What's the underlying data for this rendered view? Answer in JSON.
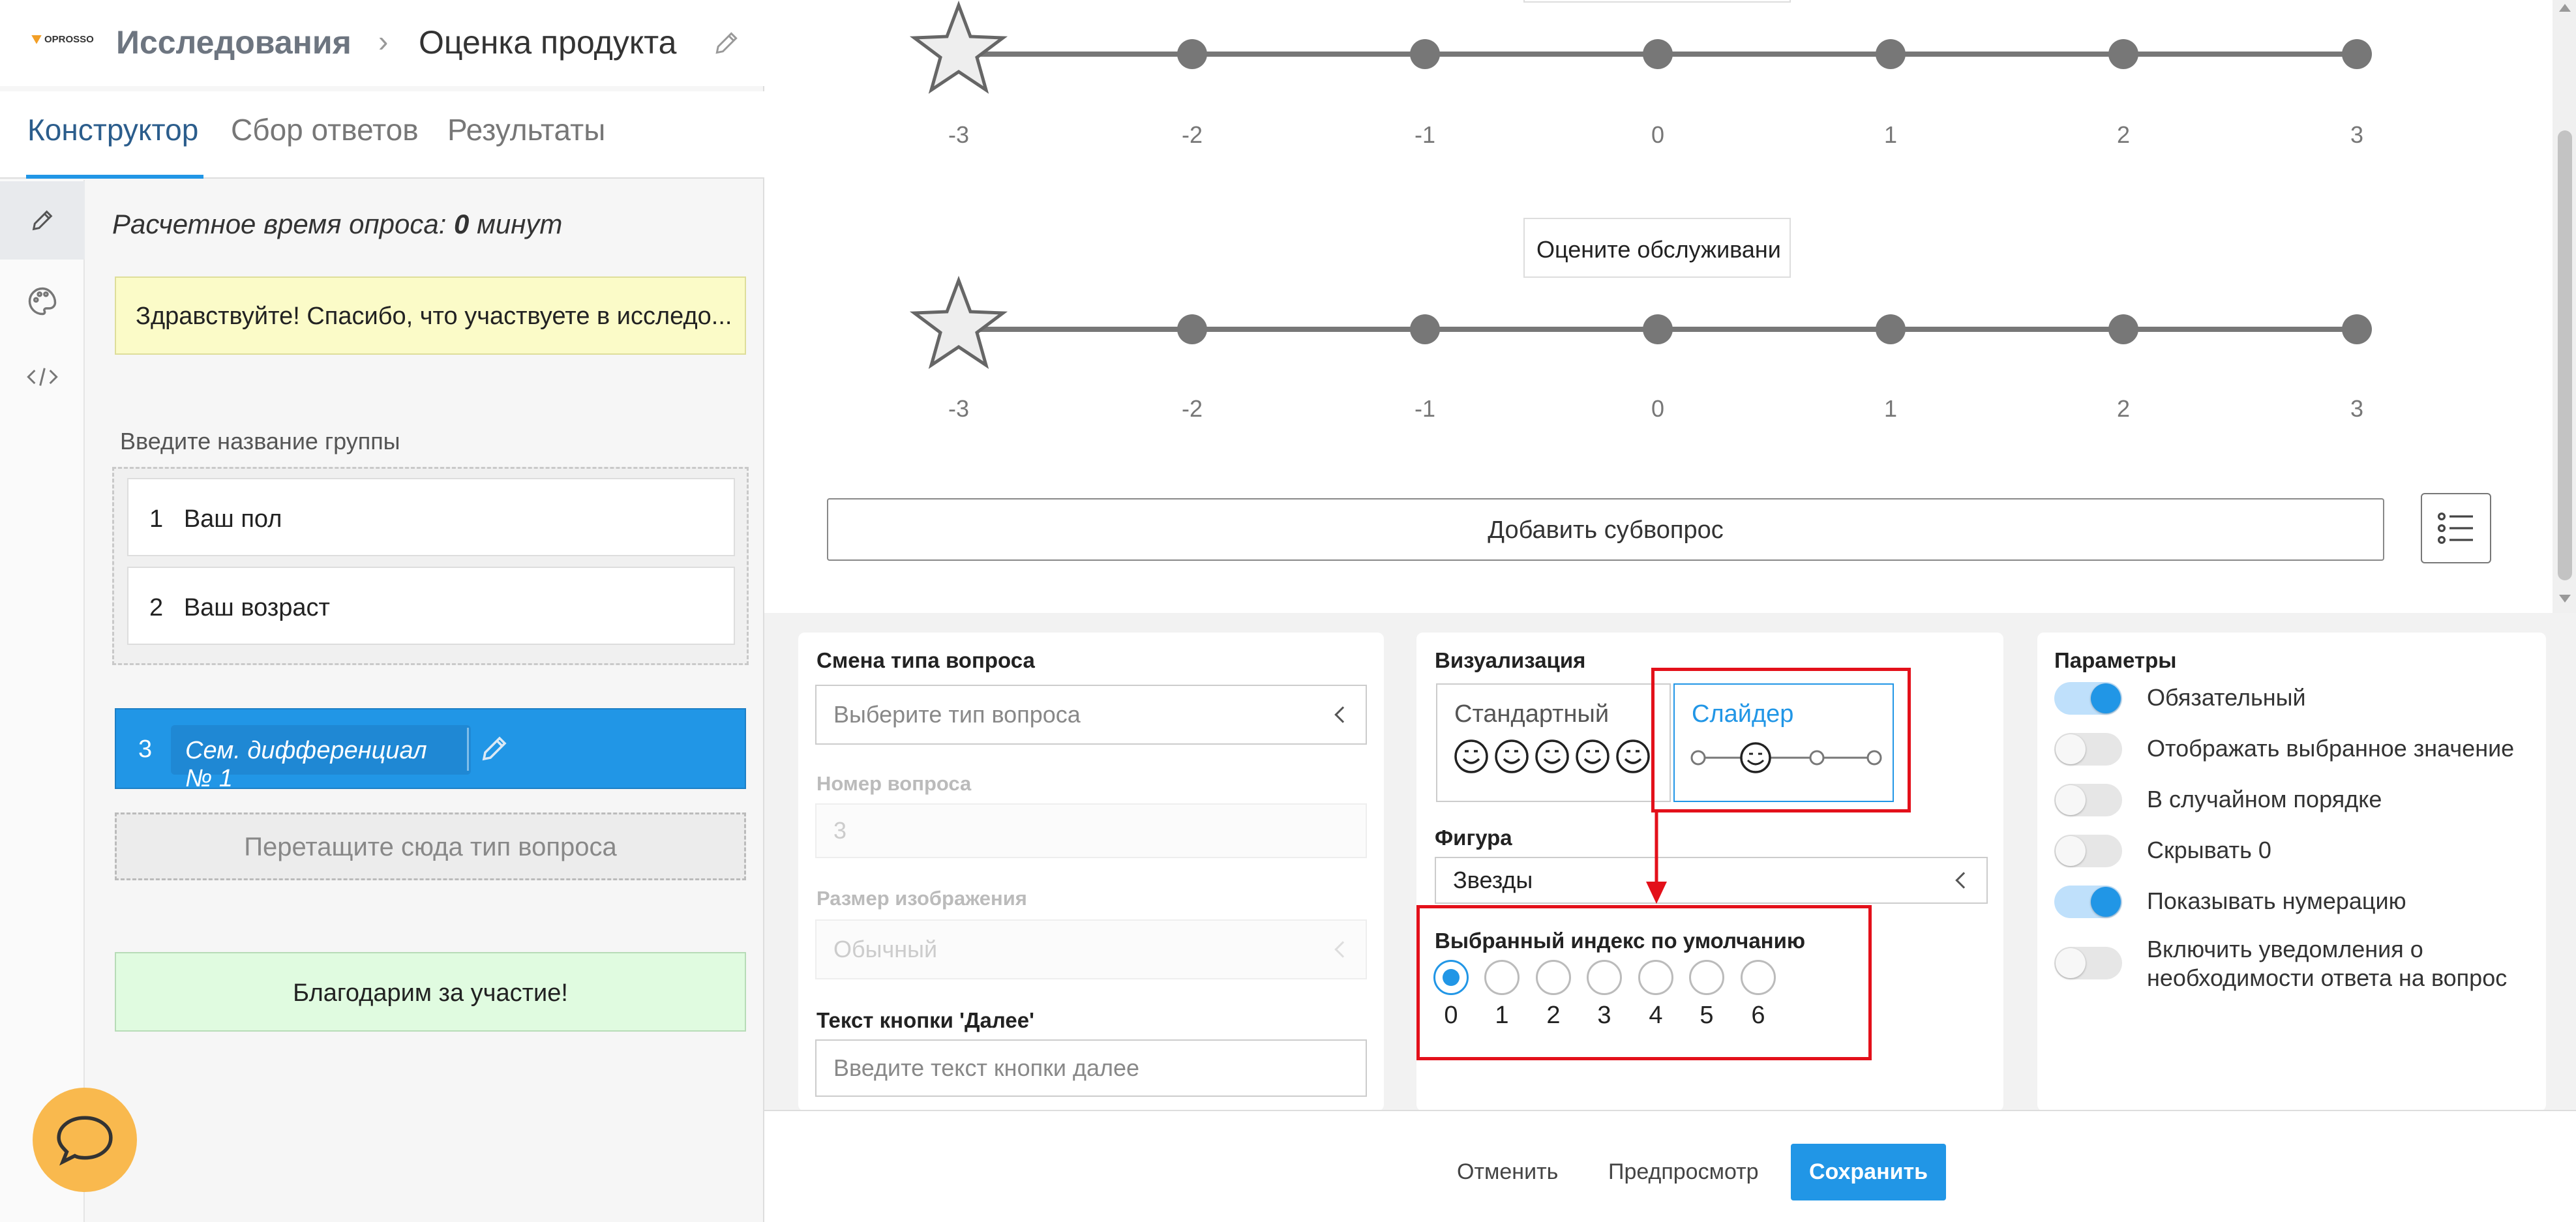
{
  "header": {
    "logo": "OPROSSO",
    "breadcrumb_root": "Исследования",
    "breadcrumb_sep": "›",
    "breadcrumb_current": "Оценка продукта"
  },
  "tabs": [
    {
      "label": "Конструктор",
      "active": true
    },
    {
      "label": "Сбор ответов",
      "active": false
    },
    {
      "label": "Результаты",
      "active": false
    }
  ],
  "rail": [
    "pencil-icon",
    "palette-icon",
    "code-icon"
  ],
  "survey": {
    "estimate_prefix": "Расчетное время опроса: ",
    "estimate_value": "0",
    "estimate_suffix": " минут",
    "welcome": "Здравствуйте! Спасибо, что участвуете в исследо...",
    "group_label": "Введите название группы",
    "group_items": [
      {
        "num": "1",
        "label": "Ваш пол"
      },
      {
        "num": "2",
        "label": "Ваш возраст"
      }
    ],
    "selected_num": "3",
    "selected_label": "Сем. дифференциал № 1",
    "drop_hint": "Перетащите сюда тип вопроса",
    "thanks": "Благодарим за участие!"
  },
  "scales": {
    "ticks": [
      "-3",
      "-2",
      "-1",
      "0",
      "1",
      "2",
      "3"
    ],
    "subquestion_label": "Оцените обслуживани"
  },
  "main": {
    "add_subquestion": "Добавить субвопрос"
  },
  "type_panel": {
    "title": "Смена типа вопроса",
    "type_placeholder": "Выберите тип вопроса",
    "number_label": "Номер вопроса",
    "number_value": "3",
    "image_size_label": "Размер изображения",
    "image_size_value": "Обычный",
    "next_label": "Текст кнопки 'Далее'",
    "next_placeholder": "Введите текст кнопки далее"
  },
  "viz_panel": {
    "title": "Визуализация",
    "option_standard": "Стандартный",
    "option_slider": "Слайдер",
    "selected_option": "Слайдер",
    "figure_label": "Фигура",
    "figure_value": "Звезды",
    "default_index_label": "Выбранный индекс по умолчанию",
    "indices": [
      "0",
      "1",
      "2",
      "3",
      "4",
      "5",
      "6"
    ],
    "selected_index": "0",
    "highlight_color": "#e3101a"
  },
  "params_panel": {
    "title": "Параметры",
    "options": [
      {
        "label": "Обязательный",
        "on": true
      },
      {
        "label": "Отображать выбранное значение",
        "on": false
      },
      {
        "label": "В случайном порядке",
        "on": false
      },
      {
        "label": "Скрывать 0",
        "on": false
      },
      {
        "label": "Показывать нумерацию",
        "on": true
      },
      {
        "label": "Включить уведомления о необходимости ответа на вопрос",
        "on": false
      }
    ]
  },
  "footer": {
    "cancel": "Отменить",
    "preview": "Предпросмотр",
    "save": "Сохранить"
  },
  "colors": {
    "accent": "#2196e6",
    "welcome_bg": "#fbfbc8",
    "thanks_bg": "#e0fbe0",
    "chat": "#f9b94e"
  }
}
